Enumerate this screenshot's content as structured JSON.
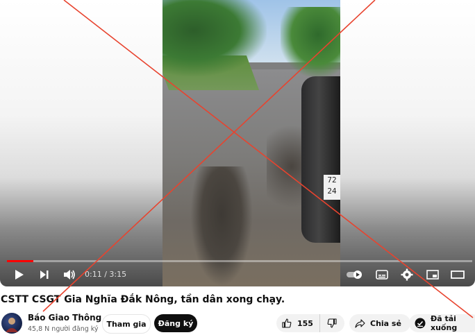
{
  "player": {
    "current_time": "0:11",
    "separator": "/",
    "duration": "3:15",
    "progress_fraction": 0.056,
    "plate_line1": "72",
    "plate_line2": "24"
  },
  "video": {
    "title": "CSTT CSGT Gia Nghĩa Đắk Nông, tần dân xong chạy."
  },
  "channel": {
    "name": "Báo Giao Thông",
    "subscribers": "45,8 N người đăng ký"
  },
  "actions": {
    "join_label": "Tham gia",
    "subscribe_label": "Đăng ký",
    "like_count": "155",
    "share_label": "Chia sẻ",
    "download_label": "Đã tải xuống"
  },
  "colors": {
    "progress": "#ff0000",
    "cross_line": "#e8432e"
  },
  "icons": [
    "play-icon",
    "next-icon",
    "volume-icon",
    "autoplay-toggle",
    "subtitles-icon",
    "settings-gear-icon",
    "miniplayer-icon",
    "theater-icon",
    "thumbs-up-icon",
    "thumbs-down-icon",
    "share-icon",
    "download-done-icon"
  ]
}
